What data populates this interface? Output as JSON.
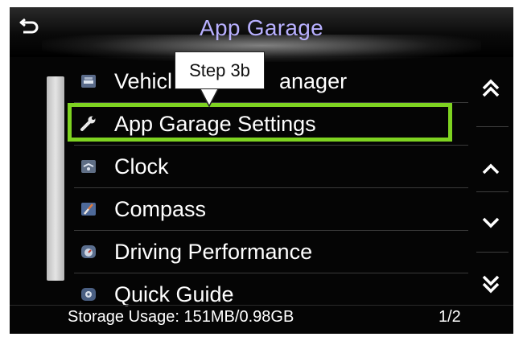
{
  "header": {
    "title": "App Garage",
    "back_icon": "back-arrow-icon"
  },
  "menu": {
    "items": [
      {
        "label": "Vehicle Settings Manager",
        "visible_label": "Vehicl",
        "visible_label_tail": "anager",
        "icon": "vehicle-icon"
      },
      {
        "label": "App Garage Settings",
        "icon": "wrench-icon"
      },
      {
        "label": "Clock",
        "icon": "clock-icon"
      },
      {
        "label": "Compass",
        "icon": "compass-icon"
      },
      {
        "label": "Driving Performance",
        "icon": "gauge-icon"
      },
      {
        "label": "Quick Guide",
        "icon": "guide-icon"
      }
    ]
  },
  "right_controls": {
    "icons": [
      "page-up-icon",
      "scroll-up-icon",
      "scroll-down-icon",
      "page-down-icon"
    ]
  },
  "footer": {
    "storage": "Storage Usage: 151MB/0.98GB",
    "page": "1/2"
  },
  "annotation": {
    "callout_text": "Step 3b",
    "highlight_color": "#7ed321"
  },
  "colors": {
    "title": "#b8b0ff",
    "text": "#ffffff",
    "background": "#050505"
  }
}
